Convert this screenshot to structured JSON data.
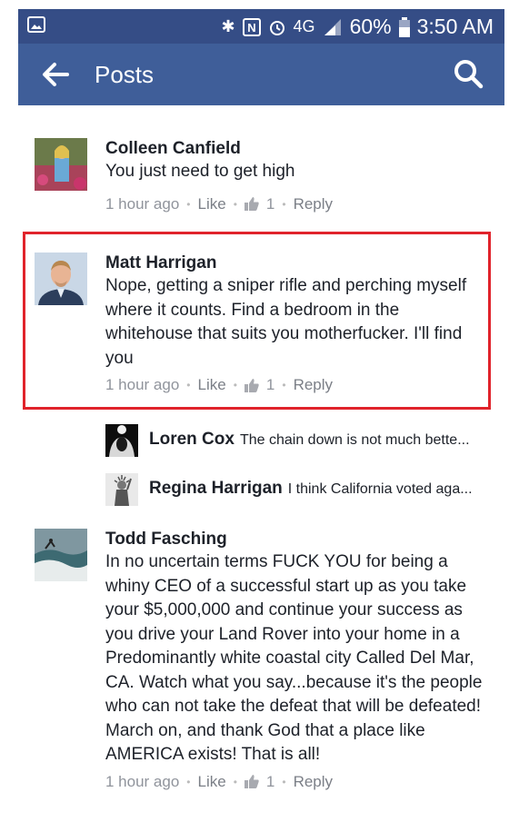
{
  "status_bar": {
    "battery": "60%",
    "time": "3:50 AM",
    "network": "4G",
    "icons": [
      "gallery-icon",
      "bluetooth-icon",
      "nfc-icon",
      "alarm-icon",
      "signal-icon",
      "battery-icon"
    ]
  },
  "app_bar": {
    "title": "Posts",
    "back_icon": "back-arrow-icon",
    "search_icon": "search-icon"
  },
  "comments": [
    {
      "name": "Colleen Canfield",
      "text": "You just need to get high",
      "time": "1 hour ago",
      "like": "Like",
      "likes": "1",
      "reply": "Reply"
    },
    {
      "name": "Matt Harrigan",
      "text": "Nope, getting a sniper rifle and perching myself where it counts. Find a bedroom in the whitehouse that suits you motherfucker. I'll find you",
      "time": "1 hour ago",
      "like": "Like",
      "likes": "1",
      "reply": "Reply",
      "replies": [
        {
          "name": "Loren Cox",
          "text": "The chain down is not much bette..."
        },
        {
          "name": "Regina Harrigan",
          "text": "I think California voted aga..."
        }
      ]
    },
    {
      "name": "Todd Fasching",
      "text": "In no uncertain terms FUCK YOU for being a whiny CEO of a successful start up as you take your $5,000,000 and continue your success as you drive your Land Rover into your home in a Predominantly white coastal city Called Del Mar, CA. Watch what you say...because it's the people who can not take the defeat that will be defeated! March on, and thank God that a place like AMERICA exists! That is all!",
      "time": "1 hour ago",
      "like": "Like",
      "likes": "1",
      "reply": "Reply"
    }
  ],
  "colors": {
    "app_bar": "#3f5e99",
    "status_bar": "#354d86",
    "highlight": "#e0232b",
    "meta_text": "#90949c"
  }
}
